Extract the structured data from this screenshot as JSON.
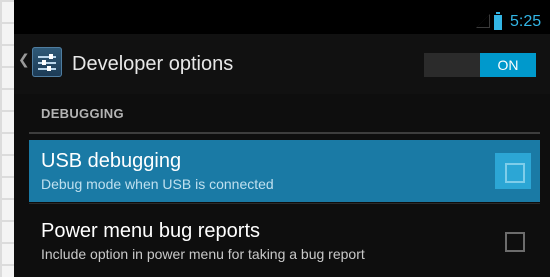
{
  "status_bar": {
    "time": "5:25",
    "signal_icon": "signal-empty-icon",
    "battery_icon": "battery-icon",
    "accent_color": "#33b5e5"
  },
  "action_bar": {
    "title": "Developer options",
    "up_icon": "up-caret-icon",
    "app_icon": "developer-settings-icon",
    "master_toggle": {
      "label": "ON",
      "state": "on"
    }
  },
  "sections": [
    {
      "header": "DEBUGGING",
      "items": [
        {
          "title": "USB debugging",
          "summary": "Debug mode when USB is connected",
          "checked": false,
          "pressed": true
        },
        {
          "title": "Power menu bug reports",
          "summary": "Include option in power menu for taking a bug report",
          "checked": false,
          "pressed": false
        }
      ]
    }
  ],
  "colors": {
    "accent": "#33b5e5",
    "selected_row": "#1a7aa5",
    "toggle_on": "#0099cc"
  }
}
